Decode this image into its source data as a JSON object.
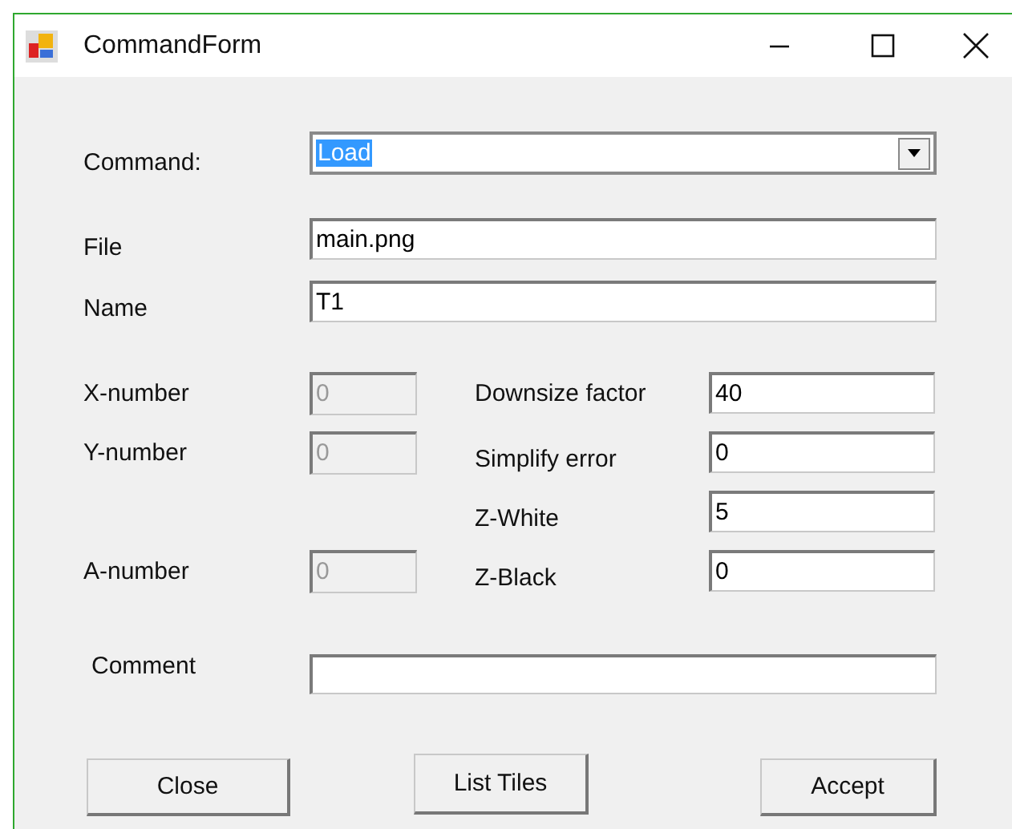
{
  "window": {
    "title": "CommandForm"
  },
  "command": {
    "label": "Command:",
    "value": "Load",
    "text_selected": true
  },
  "file": {
    "label": "File",
    "value": "main.png"
  },
  "name": {
    "label": "Name",
    "value": "T1"
  },
  "grid_rows": [
    {
      "left": {
        "label": "X-number",
        "value": "0",
        "disabled": true
      },
      "right": {
        "label": "Downsize factor",
        "value": "40",
        "disabled": false
      }
    },
    {
      "left": {
        "label": "Y-number",
        "value": "0",
        "disabled": true
      },
      "right": {
        "label": "Simplify error",
        "value": "0",
        "disabled": false
      }
    },
    {
      "right": {
        "label": "Z-White",
        "value": "5",
        "disabled": false
      }
    },
    {
      "left": {
        "label": "A-number",
        "value": "0",
        "disabled": true
      },
      "right": {
        "label": "Z-Black",
        "value": "0",
        "disabled": false
      }
    }
  ],
  "comment": {
    "label": "Comment"
  },
  "buttons": [
    "Close",
    "List Tiles",
    "Accept"
  ]
}
